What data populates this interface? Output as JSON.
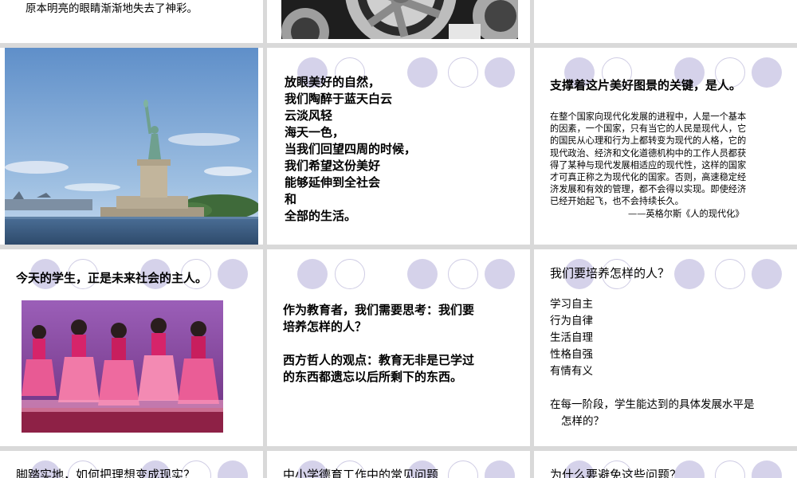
{
  "slide1": {
    "text": "原本明亮的眼睛渐渐地失去了神彩。"
  },
  "slide2": {
    "image": "gear-machinery-photo"
  },
  "slide3": {},
  "slide4": {
    "image": "statue-of-liberty-photo"
  },
  "slide5": {
    "lines": [
      "放眼美好的自然，",
      "我们陶醉于蓝天白云",
      "云淡风轻",
      "海天一色，",
      "当我们回望四周的时候，",
      "我们希望这份美好",
      "能够延伸到全社会",
      "和",
      "全部的生活。"
    ]
  },
  "slide6": {
    "title": "支撑着这片美好图景的关键，是人。",
    "paragraph_lines": [
      "在整个国家向现代化发展的进程中，人是一个基本",
      "的因素，一个国家，只有当它的人民是现代人，它",
      "的国民从心理和行为上都转变为现代的人格，它的",
      "现代政治、经济和文化道德机构中的工作人员都获",
      "得了某种与现代发展相适应的现代性，这样的国家",
      "才可真正称之为现代化的国家。否则，高速稳定经",
      "济发展和有效的管理，都不会得以实现。即使经济",
      "已经开始起飞，也不会持续长久。"
    ],
    "attribution": "——英格尔斯《人的现代化》"
  },
  "slide7": {
    "title": "今天的学生，正是未来社会的主人。",
    "image": "children-dancing-photo"
  },
  "slide8": {
    "lines1": [
      "作为教育者，我们需要思考：我们要",
      "培养怎样的人？"
    ],
    "lines2": [
      "西方哲人的观点：教育无非是已学过",
      "的东西都遗忘以后所剩下的东西。"
    ]
  },
  "slide9": {
    "title": "我们要培养怎样的人？",
    "items": [
      "学习自主",
      "行为自律",
      "生活自理",
      "性格自强",
      "有情有义"
    ],
    "footer_lines": [
      "在每一阶段，学生能达到的具体发展水平是",
      "怎样的？"
    ]
  },
  "slide10": {
    "title": "脚踏实地，如何把理想变成现实？"
  },
  "slide11": {
    "title": "中小学德育工作中的常见问题"
  },
  "slide12": {
    "title": "为什么要避免这些问题？"
  },
  "colors": {
    "background": "#d9d9d9",
    "slide": "#ffffff",
    "circle_fill": "#d5d2ea",
    "circle_ring": "#cfcce4"
  }
}
